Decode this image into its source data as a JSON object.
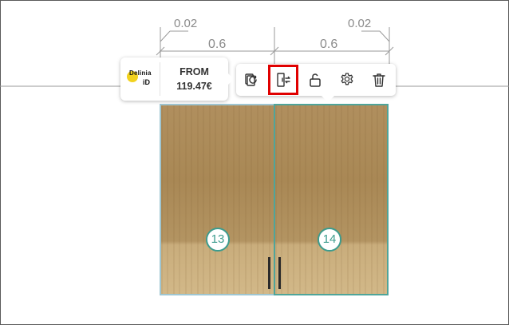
{
  "dimensions": {
    "gap_left": "0.02",
    "gap_right": "0.02",
    "width_left": "0.6",
    "width_right": "0.6"
  },
  "price_card": {
    "brand_name": "Delinia",
    "brand_sub": "iD",
    "label": "FROM",
    "value": "119.47€"
  },
  "toolbar": {
    "items": [
      {
        "icon": "replace-product-icon"
      },
      {
        "icon": "swap-door-icon",
        "highlighted": true,
        "highlight_color": "#e00000"
      },
      {
        "icon": "unlock-icon"
      },
      {
        "icon": "settings-gear-icon"
      },
      {
        "icon": "trash-icon"
      }
    ]
  },
  "cabinets": [
    {
      "number": "13"
    },
    {
      "number": "14"
    }
  ],
  "colors": {
    "selection_teal": "#4fa59a",
    "badge_teal": "#3c9c8e",
    "wood": "#b08f5e",
    "dimension_gray": "#8a8a8a"
  }
}
